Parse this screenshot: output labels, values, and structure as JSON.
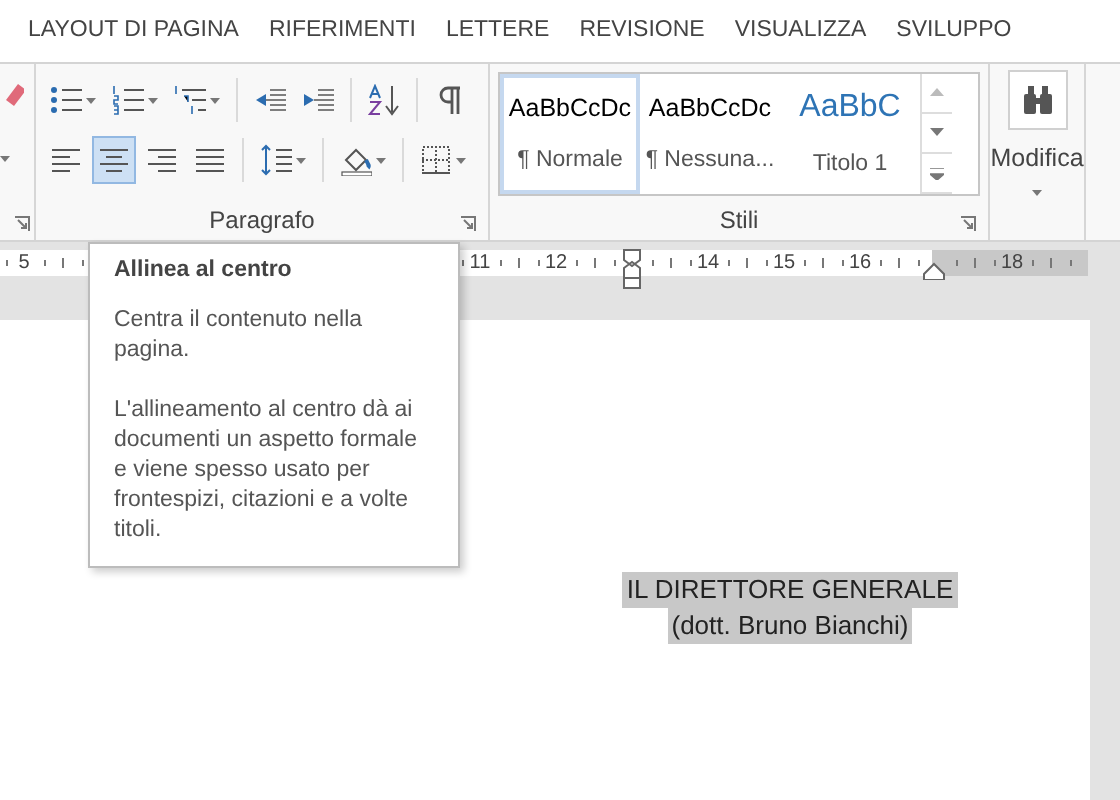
{
  "tabs": [
    {
      "label": "LAYOUT DI PAGINA",
      "selected": false
    },
    {
      "label": "RIFERIMENTI",
      "selected": false
    },
    {
      "label": "LETTERE",
      "selected": false
    },
    {
      "label": "REVISIONE",
      "selected": false
    },
    {
      "label": "VISUALIZZA",
      "selected": false
    },
    {
      "label": "SVILUPPO",
      "selected": false
    }
  ],
  "paragraph": {
    "label": "Paragrafo",
    "row_1": [
      {
        "kind": "bullets",
        "dropdown": true
      },
      {
        "kind": "numbering",
        "dropdown": true
      },
      {
        "kind": "multilevel",
        "dropdown": true
      },
      {
        "kind": "outdent",
        "dropdown": false
      },
      {
        "kind": "indent",
        "dropdown": false
      },
      {
        "kind": "sort",
        "dropdown": false
      },
      {
        "kind": "pilcrow",
        "dropdown": false
      }
    ],
    "alignment": [
      {
        "kind": "left",
        "selected": false
      },
      {
        "kind": "center",
        "selected": true
      },
      {
        "kind": "right",
        "selected": false
      },
      {
        "kind": "justify",
        "selected": false
      }
    ],
    "row_2": [
      {
        "kind": "spacing",
        "dropdown": true
      },
      {
        "kind": "shading",
        "dropdown": true
      },
      {
        "kind": "borders",
        "dropdown": true
      }
    ]
  },
  "styles": {
    "label": "Stili",
    "items": [
      {
        "sample": "AaBbCcDc",
        "name": "¶ Normale",
        "kind": "normal",
        "selected": true
      },
      {
        "sample": "AaBbCcDc",
        "name": "¶ Nessuna...",
        "kind": "normal",
        "selected": false
      },
      {
        "sample": "AaBbC",
        "name": "Titolo 1",
        "kind": "heading",
        "selected": false
      }
    ]
  },
  "editing": {
    "label": "Modifica"
  },
  "ruler": [
    {
      "number": "5"
    },
    {
      "number": "11"
    },
    {
      "number": "12"
    },
    {
      "number": "14"
    },
    {
      "number": "15"
    },
    {
      "number": "16"
    },
    {
      "number": "18"
    }
  ],
  "tooltip": {
    "title": "Allinea al centro",
    "paragraphs": [
      "Centra il contenuto nella pagina.",
      "L'allineamento al centro dà ai documenti un aspetto formale e viene spesso usato per frontespizi, citazioni e a volte titoli."
    ]
  },
  "document": {
    "lines": [
      {
        "text": "IL DIRETTORE GENERALE",
        "selected": true
      },
      {
        "text": "(dott. Bruno Bianchi)",
        "selected": true
      }
    ]
  }
}
